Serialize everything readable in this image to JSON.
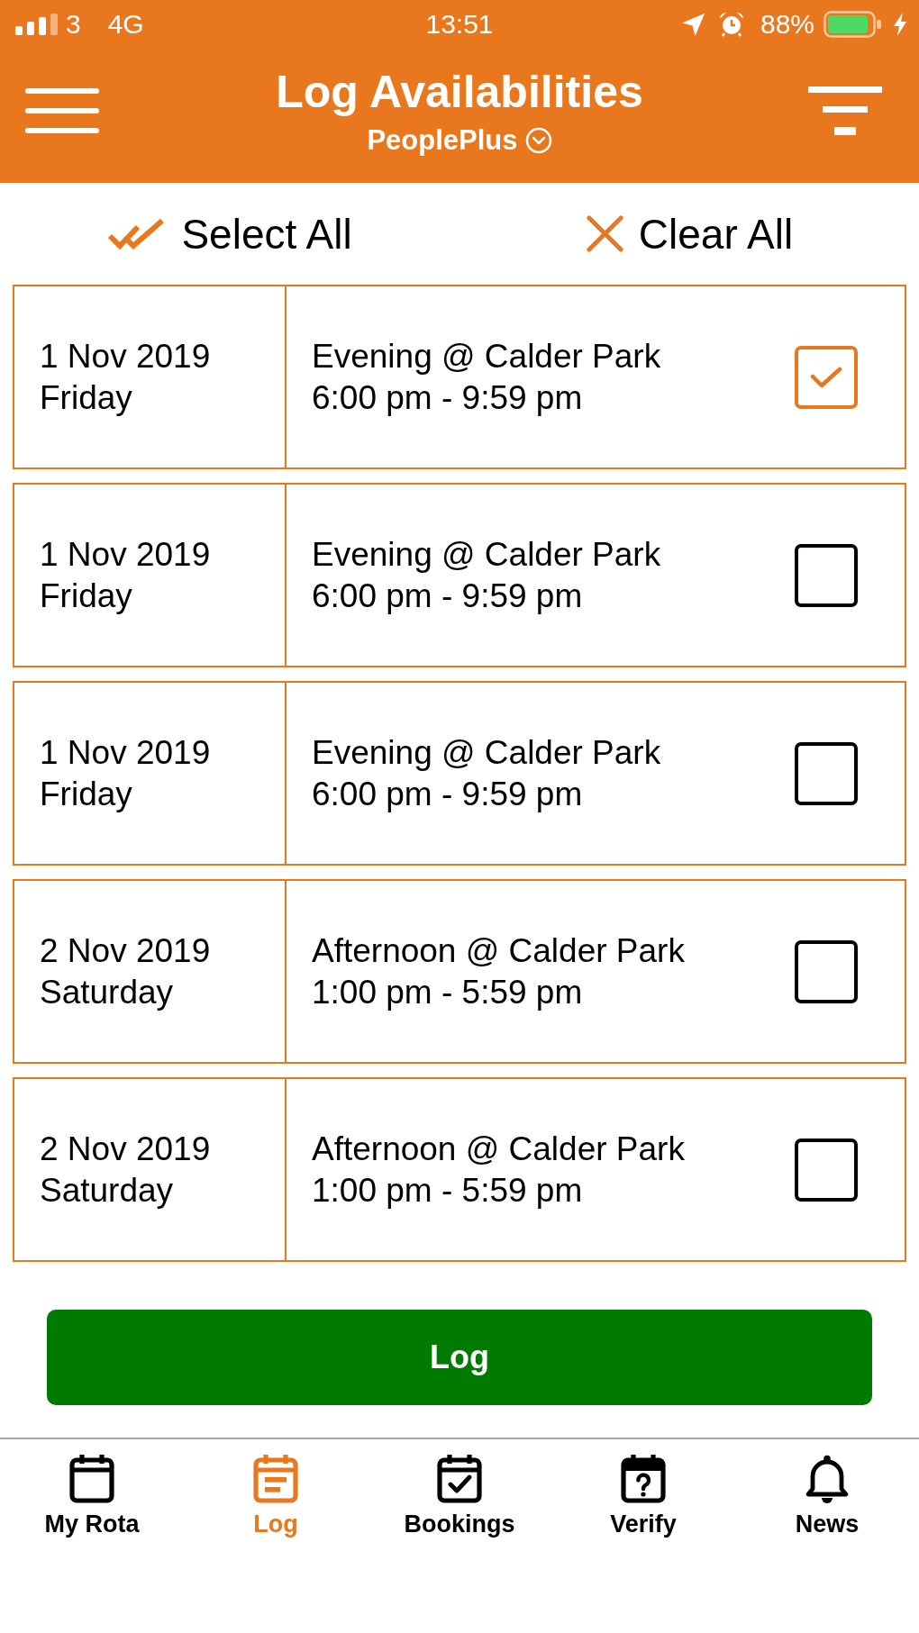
{
  "status_bar": {
    "carrier": "3",
    "network": "4G",
    "time": "13:51",
    "battery": "88%"
  },
  "header": {
    "title": "Log Availabilities",
    "subtitle": "PeoplePlus"
  },
  "actions": [
    {
      "kind": "select",
      "label": "Select All"
    },
    {
      "kind": "clear",
      "label": "Clear All"
    }
  ],
  "slots": [
    {
      "date": "1 Nov 2019",
      "day": "Friday",
      "shift": "Evening @ Calder Park",
      "time": "6:00 pm - 9:59 pm",
      "checked": true
    },
    {
      "date": "1 Nov 2019",
      "day": "Friday",
      "shift": "Evening @ Calder Park",
      "time": "6:00 pm - 9:59 pm",
      "checked": false
    },
    {
      "date": "1 Nov 2019",
      "day": "Friday",
      "shift": "Evening @ Calder Park",
      "time": "6:00 pm - 9:59 pm",
      "checked": false
    },
    {
      "date": "2 Nov 2019",
      "day": "Saturday",
      "shift": "Afternoon @ Calder Park",
      "time": "1:00 pm - 5:59 pm",
      "checked": false
    },
    {
      "date": "2 Nov 2019",
      "day": "Saturday",
      "shift": "Afternoon @ Calder Park",
      "time": "1:00 pm - 5:59 pm",
      "checked": false
    }
  ],
  "log_button": {
    "label": "Log"
  },
  "tabs": [
    {
      "kind": "calendar",
      "label": "My Rota",
      "selected": false
    },
    {
      "kind": "notes",
      "label": "Log",
      "selected": true
    },
    {
      "kind": "check",
      "label": "Bookings",
      "selected": false
    },
    {
      "kind": "question",
      "label": "Verify",
      "selected": false
    },
    {
      "kind": "bell",
      "label": "News",
      "selected": false
    }
  ]
}
